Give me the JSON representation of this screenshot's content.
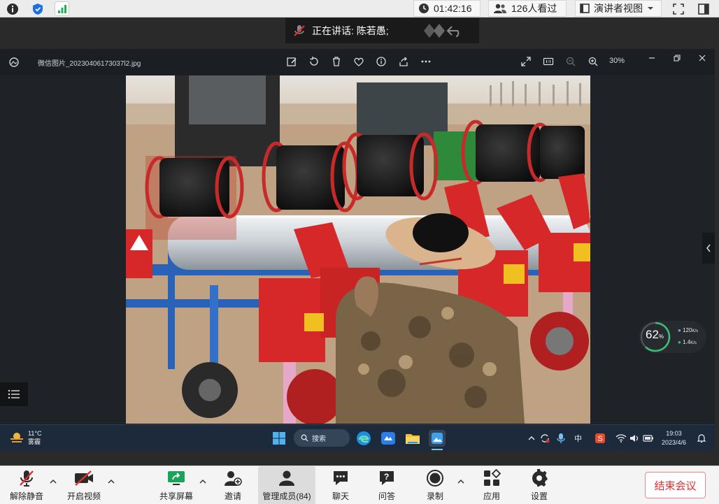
{
  "topbar": {
    "timer": "01:42:16",
    "viewers": "126人看过",
    "view_mode": "演讲者视图"
  },
  "speaker": {
    "label": "正在讲话: 陈若愚;"
  },
  "viewer": {
    "filename": "微信图片_20230406173037l2.jpg",
    "zoom": "30%"
  },
  "meter": {
    "percent": "62",
    "percent_unit": "%",
    "upload": "120",
    "download": "1.4",
    "unit": "K/s"
  },
  "taskbar": {
    "temp": "11°C",
    "weather": "雾霾",
    "search": "搜索",
    "ime": "中",
    "time": "19:03",
    "date": "2023/4/6"
  },
  "toolbar": {
    "unmute": "解除静音",
    "start_video": "开启视频",
    "share_screen": "共享屏幕",
    "invite": "邀请",
    "manage_members": "管理成员(84)",
    "chat": "聊天",
    "qa": "问答",
    "record": "录制",
    "apps": "应用",
    "settings": "设置",
    "end_meeting": "结束会议"
  },
  "colors": {
    "end_red": "#e03030",
    "taskbar": "#1c2a3c",
    "meter_green": "#3cc07a"
  }
}
